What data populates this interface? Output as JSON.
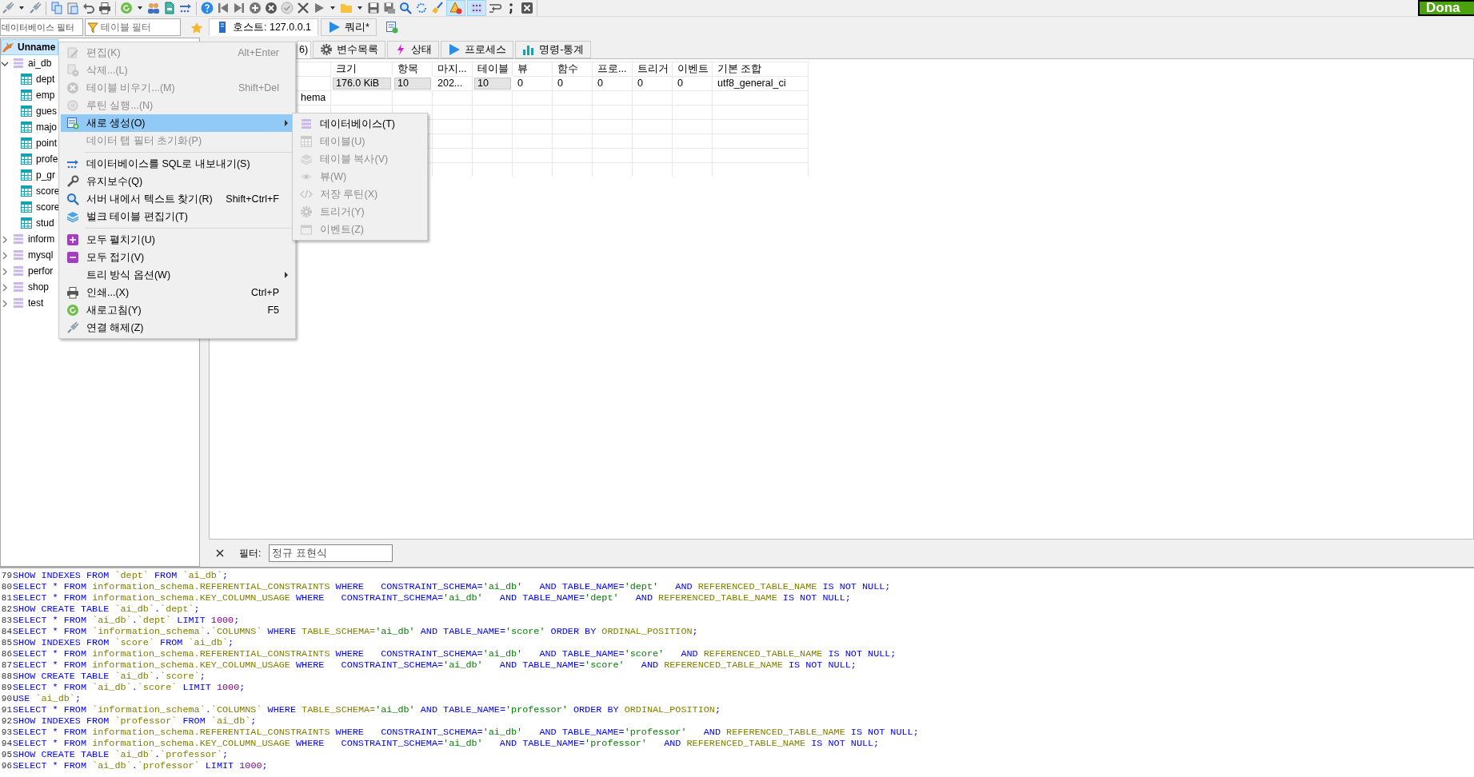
{
  "toolbar": {
    "toggle_buttons": [
      {
        "pressed": true
      },
      {
        "pressed": true
      }
    ],
    "donate_button": "Dona"
  },
  "database_filter": {
    "placeholder": "데이터베이스 필터"
  },
  "table_filter": {
    "placeholder": "테이블 필터"
  },
  "tree": {
    "connection": {
      "label": "Unname",
      "selected": true
    },
    "databases": [
      {
        "label": "ai_db",
        "expanded": true,
        "children": [
          {
            "label": "dept"
          },
          {
            "label": "emp"
          },
          {
            "label": "gues"
          },
          {
            "label": "majo"
          },
          {
            "label": "point"
          },
          {
            "label": "profe"
          },
          {
            "label": "p_gr"
          },
          {
            "label": "score"
          },
          {
            "label": "score"
          },
          {
            "label": "stud"
          }
        ]
      },
      {
        "label": "inform",
        "expanded": false
      },
      {
        "label": "mysql",
        "expanded": false
      },
      {
        "label": "perfor",
        "expanded": false
      },
      {
        "label": "shop",
        "expanded": false
      },
      {
        "label": "test",
        "expanded": false
      }
    ]
  },
  "query_tabs": [
    {
      "label": "호스트: 127.0.0.1",
      "kind": "host",
      "selected": true
    },
    {
      "label": "쿼리*",
      "kind": "query",
      "selected": false
    }
  ],
  "host_tabs": [
    {
      "label": "6)",
      "kind": "database",
      "selected": true
    },
    {
      "label": "변수목록",
      "kind": "variables",
      "selected": false
    },
    {
      "label": "상태",
      "kind": "status",
      "selected": false
    },
    {
      "label": "프로세스",
      "kind": "processes",
      "selected": false
    },
    {
      "label": "명령-통계",
      "kind": "statistics",
      "selected": false
    }
  ],
  "grid": {
    "columns": [
      "크기",
      "항목",
      "마지...",
      "테이블",
      "뷰",
      "함수",
      "프로...",
      "트리거",
      "이벤트",
      "기본 조합"
    ],
    "rows": [
      {
        "cells": [
          {
            "text": "176.0 KiB",
            "kind": "bar"
          },
          {
            "text": "10",
            "kind": "bar"
          },
          {
            "text": "202...",
            "kind": "text"
          },
          {
            "text": "10",
            "kind": "bar"
          },
          {
            "text": "0",
            "kind": "text"
          },
          {
            "text": "0",
            "kind": "text"
          },
          {
            "text": "0",
            "kind": "text"
          },
          {
            "text": "0",
            "kind": "text"
          },
          {
            "text": "0",
            "kind": "text"
          },
          {
            "text": "utf8_general_ci",
            "kind": "text"
          }
        ]
      },
      {
        "name": "hema"
      }
    ]
  },
  "filter": {
    "label": "필터:",
    "placeholder": "정규 표현식"
  },
  "context_menu": {
    "items": [
      {
        "kind": "item",
        "label": "편집(K)",
        "shortcut": "Alt+Enter",
        "disabled": true,
        "selected": false,
        "submenu": false
      },
      {
        "kind": "item",
        "label": "삭제...(L)",
        "disabled": true,
        "selected": false,
        "submenu": false
      },
      {
        "kind": "item",
        "label": "테이블 비우기...(M)",
        "shortcut": "Shift+Del",
        "disabled": true,
        "selected": false,
        "submenu": false
      },
      {
        "kind": "item",
        "label": "루틴 실행...(N)",
        "disabled": true,
        "selected": false,
        "submenu": false
      },
      {
        "kind": "item",
        "label": "새로 생성(O)",
        "disabled": false,
        "selected": true,
        "submenu": true
      },
      {
        "kind": "item",
        "label": "데이터 탭 필터 초기화(P)",
        "disabled": true,
        "selected": false,
        "submenu": false
      },
      {
        "kind": "separator"
      },
      {
        "kind": "item",
        "label": "데이터베이스를 SQL로 내보내기(S)",
        "disabled": false,
        "selected": false,
        "submenu": false
      },
      {
        "kind": "item",
        "label": "유지보수(Q)",
        "disabled": false,
        "selected": false,
        "submenu": false
      },
      {
        "kind": "item",
        "label": "서버 내에서 텍스트 찾기(R)",
        "shortcut": "Shift+Ctrl+F",
        "disabled": false,
        "selected": false,
        "submenu": false
      },
      {
        "kind": "item",
        "label": "벌크 테이블 편집기(T)",
        "disabled": false,
        "selected": false,
        "submenu": false
      },
      {
        "kind": "separator"
      },
      {
        "kind": "item",
        "label": "모두 펼치기(U)",
        "disabled": false,
        "selected": false,
        "submenu": false
      },
      {
        "kind": "item",
        "label": "모두 접기(V)",
        "disabled": false,
        "selected": false,
        "submenu": false
      },
      {
        "kind": "item",
        "label": "트리 방식 옵션(W)",
        "disabled": false,
        "selected": false,
        "submenu": true
      },
      {
        "kind": "item",
        "label": "인쇄...(X)",
        "shortcut": "Ctrl+P",
        "disabled": false,
        "selected": false,
        "submenu": false
      },
      {
        "kind": "item",
        "label": "새로고침(Y)",
        "shortcut": "F5",
        "disabled": false,
        "selected": false,
        "submenu": false
      },
      {
        "kind": "item",
        "label": "연결 해제(Z)",
        "disabled": false,
        "selected": false,
        "submenu": false
      }
    ]
  },
  "submenu": {
    "items": [
      {
        "label": "데이터베이스(T)",
        "disabled": false
      },
      {
        "label": "테이블(U)",
        "disabled": true
      },
      {
        "label": "테이블 복사(V)",
        "disabled": true
      },
      {
        "label": "뷰(W)",
        "disabled": true
      },
      {
        "label": "저장 루틴(X)",
        "disabled": true
      },
      {
        "label": "트리거(Y)",
        "disabled": true
      },
      {
        "label": "이벤트(Z)",
        "disabled": true
      }
    ]
  },
  "log": [
    {
      "number": "79",
      "tokens": [
        {
          "kind": "kw",
          "text": "SHOW INDEXES FROM "
        },
        {
          "kind": "id",
          "text": "`dept`"
        },
        {
          "kind": "kw",
          "text": " FROM "
        },
        {
          "kind": "id",
          "text": "`ai_db`"
        },
        {
          "kind": "kw",
          "text": ";"
        }
      ]
    },
    {
      "number": "80",
      "tokens": [
        {
          "kind": "kw",
          "text": "SELECT * FROM "
        },
        {
          "kind": "id",
          "text": "information_schema.REFERENTIAL_CONSTRAINTS"
        },
        {
          "kind": "kw",
          "text": " WHERE   CONSTRAINT_SCHEMA="
        },
        {
          "kind": "str",
          "text": "'ai_db'"
        },
        {
          "kind": "kw",
          "text": "   AND TABLE_NAME="
        },
        {
          "kind": "str",
          "text": "'dept'"
        },
        {
          "kind": "kw",
          "text": "   AND "
        },
        {
          "kind": "id",
          "text": "REFERENCED_TABLE_NAME"
        },
        {
          "kind": "kw",
          "text": " IS NOT NULL;"
        }
      ]
    },
    {
      "number": "81",
      "tokens": [
        {
          "kind": "kw",
          "text": "SELECT * FROM "
        },
        {
          "kind": "id",
          "text": "information_schema.KEY_COLUMN_USAGE"
        },
        {
          "kind": "kw",
          "text": " WHERE   CONSTRAINT_SCHEMA="
        },
        {
          "kind": "str",
          "text": "'ai_db'"
        },
        {
          "kind": "kw",
          "text": "   AND TABLE_NAME="
        },
        {
          "kind": "str",
          "text": "'dept'"
        },
        {
          "kind": "kw",
          "text": "   AND "
        },
        {
          "kind": "id",
          "text": "REFERENCED_TABLE_NAME"
        },
        {
          "kind": "kw",
          "text": " IS NOT NULL;"
        }
      ]
    },
    {
      "number": "82",
      "tokens": [
        {
          "kind": "kw",
          "text": "SHOW CREATE TABLE "
        },
        {
          "kind": "id",
          "text": "`ai_db`"
        },
        {
          "kind": "kw",
          "text": "."
        },
        {
          "kind": "id",
          "text": "`dept`"
        },
        {
          "kind": "kw",
          "text": ";"
        }
      ]
    },
    {
      "number": "83",
      "tokens": [
        {
          "kind": "kw",
          "text": "SELECT * FROM "
        },
        {
          "kind": "id",
          "text": "`ai_db`"
        },
        {
          "kind": "kw",
          "text": "."
        },
        {
          "kind": "id",
          "text": "`dept`"
        },
        {
          "kind": "kw",
          "text": " LIMIT "
        },
        {
          "kind": "num",
          "text": "1000"
        },
        {
          "kind": "kw",
          "text": ";"
        }
      ]
    },
    {
      "number": "84",
      "tokens": [
        {
          "kind": "kw",
          "text": "SELECT * FROM "
        },
        {
          "kind": "id",
          "text": "`information_schema`"
        },
        {
          "kind": "kw",
          "text": "."
        },
        {
          "kind": "id",
          "text": "`COLUMNS`"
        },
        {
          "kind": "kw",
          "text": " WHERE "
        },
        {
          "kind": "id",
          "text": "TABLE_SCHEMA="
        },
        {
          "kind": "str",
          "text": "'ai_db'"
        },
        {
          "kind": "kw",
          "text": " AND TABLE_NAME="
        },
        {
          "kind": "str",
          "text": "'score'"
        },
        {
          "kind": "kw",
          "text": " ORDER BY "
        },
        {
          "kind": "id",
          "text": "ORDINAL_POSITION"
        },
        {
          "kind": "kw",
          "text": ";"
        }
      ]
    },
    {
      "number": "85",
      "tokens": [
        {
          "kind": "kw",
          "text": "SHOW INDEXES FROM "
        },
        {
          "kind": "id",
          "text": "`score`"
        },
        {
          "kind": "kw",
          "text": " FROM "
        },
        {
          "kind": "id",
          "text": "`ai_db`"
        },
        {
          "kind": "kw",
          "text": ";"
        }
      ]
    },
    {
      "number": "86",
      "tokens": [
        {
          "kind": "kw",
          "text": "SELECT * FROM "
        },
        {
          "kind": "id",
          "text": "information_schema.REFERENTIAL_CONSTRAINTS"
        },
        {
          "kind": "kw",
          "text": " WHERE   CONSTRAINT_SCHEMA="
        },
        {
          "kind": "str",
          "text": "'ai_db'"
        },
        {
          "kind": "kw",
          "text": "   AND TABLE_NAME="
        },
        {
          "kind": "str",
          "text": "'score'"
        },
        {
          "kind": "kw",
          "text": "   AND "
        },
        {
          "kind": "id",
          "text": "REFERENCED_TABLE_NAME"
        },
        {
          "kind": "kw",
          "text": " IS NOT NULL;"
        }
      ]
    },
    {
      "number": "87",
      "tokens": [
        {
          "kind": "kw",
          "text": "SELECT * FROM "
        },
        {
          "kind": "id",
          "text": "information_schema.KEY_COLUMN_USAGE"
        },
        {
          "kind": "kw",
          "text": " WHERE   CONSTRAINT_SCHEMA="
        },
        {
          "kind": "str",
          "text": "'ai_db'"
        },
        {
          "kind": "kw",
          "text": "   AND TABLE_NAME="
        },
        {
          "kind": "str",
          "text": "'score'"
        },
        {
          "kind": "kw",
          "text": "   AND "
        },
        {
          "kind": "id",
          "text": "REFERENCED_TABLE_NAME"
        },
        {
          "kind": "kw",
          "text": " IS NOT NULL;"
        }
      ]
    },
    {
      "number": "88",
      "tokens": [
        {
          "kind": "kw",
          "text": "SHOW CREATE TABLE "
        },
        {
          "kind": "id",
          "text": "`ai_db`"
        },
        {
          "kind": "kw",
          "text": "."
        },
        {
          "kind": "id",
          "text": "`score`"
        },
        {
          "kind": "kw",
          "text": ";"
        }
      ]
    },
    {
      "number": "89",
      "tokens": [
        {
          "kind": "kw",
          "text": "SELECT * FROM "
        },
        {
          "kind": "id",
          "text": "`ai_db`"
        },
        {
          "kind": "kw",
          "text": "."
        },
        {
          "kind": "id",
          "text": "`score`"
        },
        {
          "kind": "kw",
          "text": " LIMIT "
        },
        {
          "kind": "num",
          "text": "1000"
        },
        {
          "kind": "kw",
          "text": ";"
        }
      ]
    },
    {
      "number": "90",
      "tokens": [
        {
          "kind": "kw",
          "text": "USE "
        },
        {
          "kind": "id",
          "text": "`ai_db`"
        },
        {
          "kind": "kw",
          "text": ";"
        }
      ]
    },
    {
      "number": "91",
      "tokens": [
        {
          "kind": "kw",
          "text": "SELECT * FROM "
        },
        {
          "kind": "id",
          "text": "`information_schema`"
        },
        {
          "kind": "kw",
          "text": "."
        },
        {
          "kind": "id",
          "text": "`COLUMNS`"
        },
        {
          "kind": "kw",
          "text": " WHERE "
        },
        {
          "kind": "id",
          "text": "TABLE_SCHEMA="
        },
        {
          "kind": "str",
          "text": "'ai_db'"
        },
        {
          "kind": "kw",
          "text": " AND TABLE_NAME="
        },
        {
          "kind": "str",
          "text": "'professor'"
        },
        {
          "kind": "kw",
          "text": " ORDER BY "
        },
        {
          "kind": "id",
          "text": "ORDINAL_POSITION"
        },
        {
          "kind": "kw",
          "text": ";"
        }
      ]
    },
    {
      "number": "92",
      "tokens": [
        {
          "kind": "kw",
          "text": "SHOW INDEXES FROM "
        },
        {
          "kind": "id",
          "text": "`professor`"
        },
        {
          "kind": "kw",
          "text": " FROM "
        },
        {
          "kind": "id",
          "text": "`ai_db`"
        },
        {
          "kind": "kw",
          "text": ";"
        }
      ]
    },
    {
      "number": "93",
      "tokens": [
        {
          "kind": "kw",
          "text": "SELECT * FROM "
        },
        {
          "kind": "id",
          "text": "information_schema.REFERENTIAL_CONSTRAINTS"
        },
        {
          "kind": "kw",
          "text": " WHERE   CONSTRAINT_SCHEMA="
        },
        {
          "kind": "str",
          "text": "'ai_db'"
        },
        {
          "kind": "kw",
          "text": "   AND TABLE_NAME="
        },
        {
          "kind": "str",
          "text": "'professor'"
        },
        {
          "kind": "kw",
          "text": "   AND "
        },
        {
          "kind": "id",
          "text": "REFERENCED_TABLE_NAME"
        },
        {
          "kind": "kw",
          "text": " IS NOT NULL;"
        }
      ]
    },
    {
      "number": "94",
      "tokens": [
        {
          "kind": "kw",
          "text": "SELECT * FROM "
        },
        {
          "kind": "id",
          "text": "information_schema.KEY_COLUMN_USAGE"
        },
        {
          "kind": "kw",
          "text": " WHERE   CONSTRAINT_SCHEMA="
        },
        {
          "kind": "str",
          "text": "'ai_db'"
        },
        {
          "kind": "kw",
          "text": "   AND TABLE_NAME="
        },
        {
          "kind": "str",
          "text": "'professor'"
        },
        {
          "kind": "kw",
          "text": "   AND "
        },
        {
          "kind": "id",
          "text": "REFERENCED_TABLE_NAME"
        },
        {
          "kind": "kw",
          "text": " IS NOT NULL;"
        }
      ]
    },
    {
      "number": "95",
      "tokens": [
        {
          "kind": "kw",
          "text": "SHOW CREATE TABLE "
        },
        {
          "kind": "id",
          "text": "`ai_db`"
        },
        {
          "kind": "kw",
          "text": "."
        },
        {
          "kind": "id",
          "text": "`professor`"
        },
        {
          "kind": "kw",
          "text": ";"
        }
      ]
    },
    {
      "number": "96",
      "tokens": [
        {
          "kind": "kw",
          "text": "SELECT * FROM "
        },
        {
          "kind": "id",
          "text": "`ai_db`"
        },
        {
          "kind": "kw",
          "text": "."
        },
        {
          "kind": "id",
          "text": "`professor`"
        },
        {
          "kind": "kw",
          "text": " LIMIT "
        },
        {
          "kind": "num",
          "text": "1000"
        },
        {
          "kind": "kw",
          "text": ";"
        }
      ]
    }
  ]
}
